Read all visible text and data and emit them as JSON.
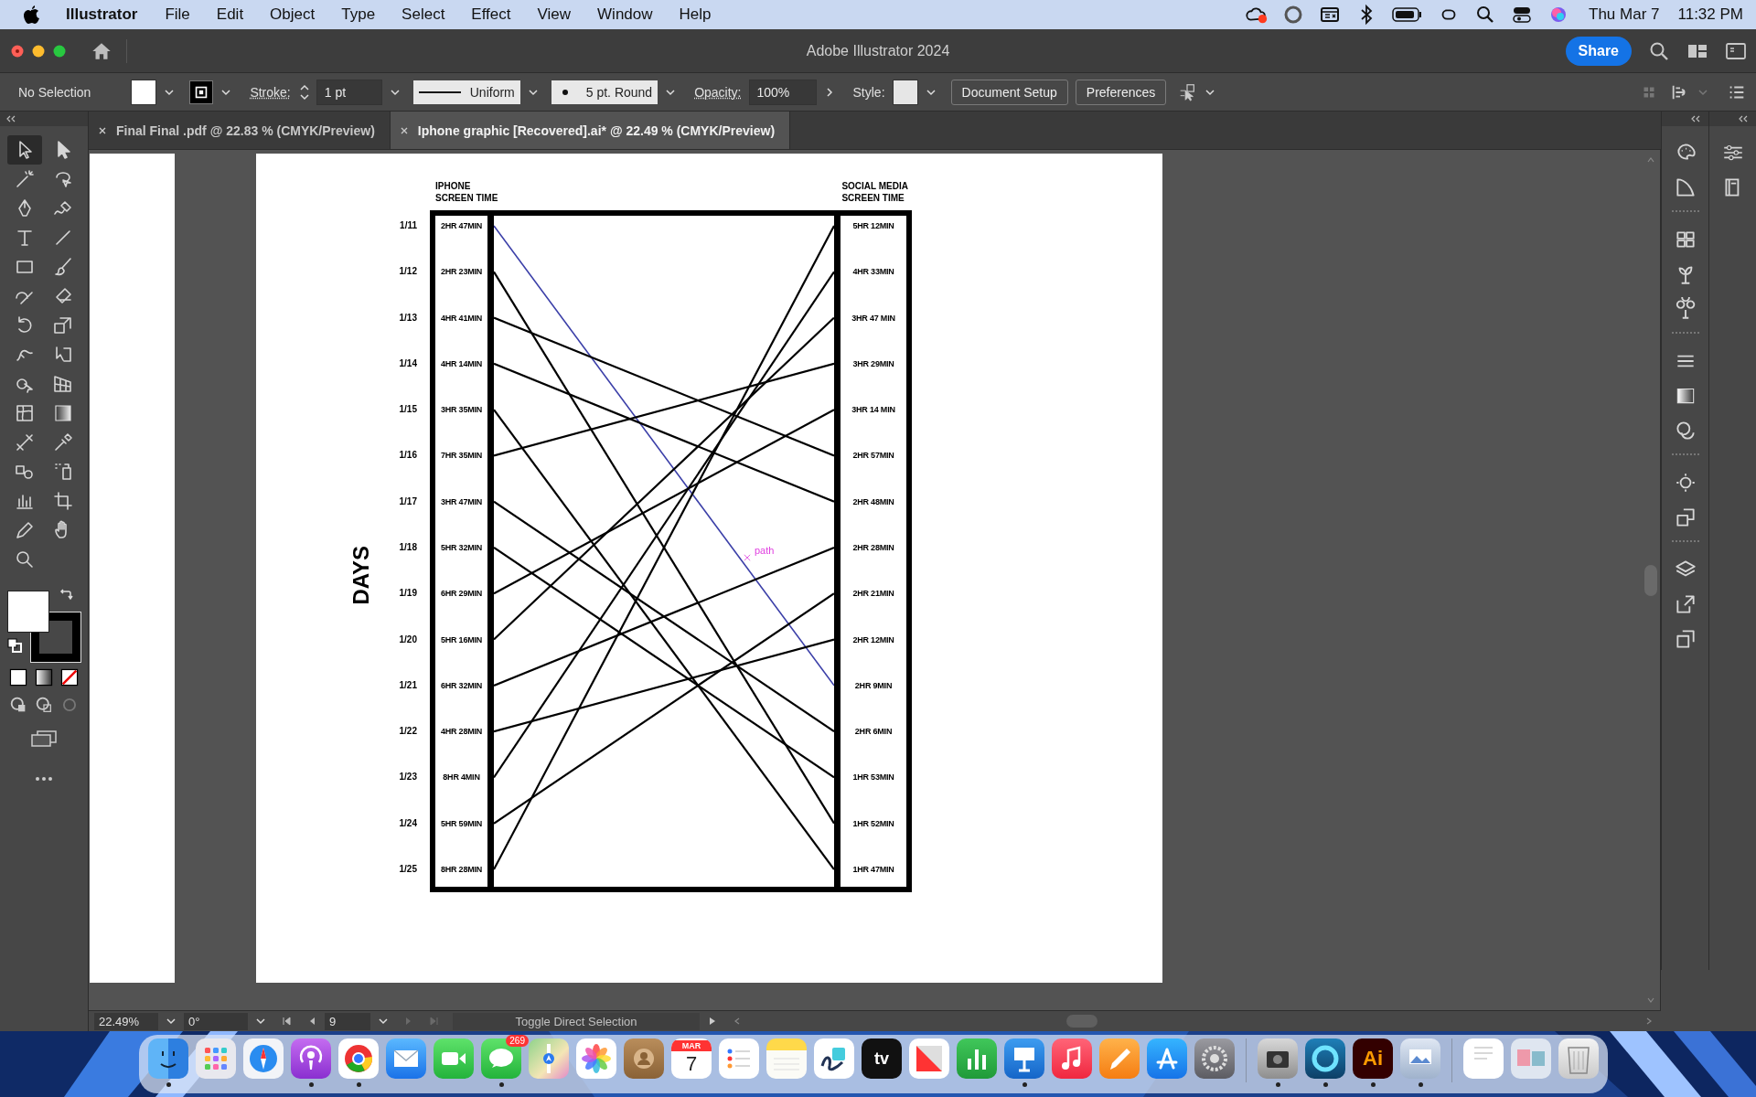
{
  "menu_bar": {
    "app": "Illustrator",
    "menus": [
      "File",
      "Edit",
      "Object",
      "Type",
      "Select",
      "Effect",
      "View",
      "Window",
      "Help"
    ],
    "date": "Thu Mar 7",
    "time": "11:32 PM"
  },
  "window": {
    "title": "Adobe Illustrator 2024",
    "share": "Share"
  },
  "control_bar": {
    "selection": "No Selection",
    "stroke_label": "Stroke:",
    "stroke_value": "1 pt",
    "profile": "Uniform",
    "brush": "5 pt. Round",
    "opacity_label": "Opacity:",
    "opacity_value": "100%",
    "style_label": "Style:",
    "buttons": [
      "Document Setup",
      "Preferences"
    ]
  },
  "tabs": [
    {
      "label": "Final Final .pdf @ 22.83 % (CMYK/Preview)",
      "selected": false
    },
    {
      "label": "Iphone graphic [Recovered].ai* @ 22.49 % (CMYK/Preview)",
      "selected": true
    }
  ],
  "tools": [
    {
      "selected": true
    },
    {
      "selected": false
    },
    {
      "selected": false
    },
    {
      "selected": false
    },
    {
      "selected": false
    },
    {
      "selected": false
    },
    {
      "selected": false
    },
    {
      "selected": false
    },
    {
      "selected": false
    },
    {
      "selected": false
    },
    {
      "selected": false
    },
    {
      "selected": false
    },
    {
      "selected": false
    },
    {
      "selected": false
    },
    {
      "selected": false
    },
    {
      "selected": false
    },
    {
      "selected": false
    },
    {
      "selected": false
    },
    {
      "selected": false
    },
    {
      "selected": false
    },
    {
      "selected": false
    },
    {
      "selected": false
    },
    {
      "selected": false
    },
    {
      "selected": false
    },
    {
      "selected": false
    },
    {
      "selected": false
    },
    {
      "selected": false
    },
    {
      "selected": false
    },
    {
      "selected": false
    }
  ],
  "artboard": {
    "left_header": [
      "IPHONE",
      "SCREEN TIME"
    ],
    "right_header": [
      "SOCIAL MEDIA",
      "SCREEN TIME"
    ],
    "axis_label": "DAYS",
    "path_hint": "path",
    "rows": [
      {
        "date": "1/11",
        "iphone": "2HR 47MIN",
        "social": "5HR 12MIN"
      },
      {
        "date": "1/12",
        "iphone": "2HR 23MIN",
        "social": "4HR 33MIN"
      },
      {
        "date": "1/13",
        "iphone": "4HR 41MIN",
        "social": "3HR 47 MIN"
      },
      {
        "date": "1/14",
        "iphone": "4HR 14MIN",
        "social": "3HR 29MIN"
      },
      {
        "date": "1/15",
        "iphone": "3HR 35MIN",
        "social": "3HR 14 MIN"
      },
      {
        "date": "1/16",
        "iphone": "7HR 35MIN",
        "social": "2HR 57MIN"
      },
      {
        "date": "1/17",
        "iphone": "3HR 47MIN",
        "social": "2HR 48MIN"
      },
      {
        "date": "1/18",
        "iphone": "5HR 32MIN",
        "social": "2HR 28MIN"
      },
      {
        "date": "1/19",
        "iphone": "6HR 29MIN",
        "social": "2HR 21MIN"
      },
      {
        "date": "1/20",
        "iphone": "5HR 16MIN",
        "social": "2HR 12MIN"
      },
      {
        "date": "1/21",
        "iphone": "6HR 32MIN",
        "social": "2HR 9MIN"
      },
      {
        "date": "1/22",
        "iphone": "4HR 28MIN",
        "social": "2HR 6MIN"
      },
      {
        "date": "1/23",
        "iphone": "8HR 4MIN",
        "social": "1HR 53MIN"
      },
      {
        "date": "1/24",
        "iphone": "5HR 59MIN",
        "social": "1HR 52MIN"
      },
      {
        "date": "1/25",
        "iphone": "8HR 28MIN",
        "social": "1HR 47MIN"
      }
    ]
  },
  "status_bar": {
    "zoom": "22.49%",
    "rotation": "0°",
    "artboard": "9",
    "tool": "Toggle Direct Selection"
  },
  "dock": [
    {
      "kind": "finder",
      "running": true
    },
    {
      "kind": "launchpad",
      "running": false
    },
    {
      "kind": "safari",
      "running": false
    },
    {
      "kind": "podcasts",
      "running": true
    },
    {
      "kind": "chrome",
      "running": true
    },
    {
      "kind": "mail",
      "running": false
    },
    {
      "kind": "facetime",
      "running": false
    },
    {
      "kind": "messages",
      "running": true,
      "badge": "269"
    },
    {
      "kind": "maps",
      "running": false
    },
    {
      "kind": "photos",
      "running": false
    },
    {
      "kind": "contacts",
      "running": false
    },
    {
      "kind": "calendar",
      "running": false,
      "month": "MAR",
      "day": "7"
    },
    {
      "kind": "reminders",
      "running": false
    },
    {
      "kind": "notes",
      "running": false
    },
    {
      "kind": "freeform",
      "running": false
    },
    {
      "kind": "tv",
      "running": false,
      "label": "tv"
    },
    {
      "kind": "news",
      "running": false
    },
    {
      "kind": "numbers",
      "running": false
    },
    {
      "kind": "keynote",
      "running": true
    },
    {
      "kind": "music",
      "running": false
    },
    {
      "kind": "pages",
      "running": false
    },
    {
      "kind": "appstore",
      "running": false
    },
    {
      "kind": "settings",
      "running": false
    },
    {
      "kind": "separator"
    },
    {
      "kind": "screenshot",
      "running": true
    },
    {
      "kind": "ring",
      "running": true
    },
    {
      "kind": "illustrator",
      "running": true,
      "label": "Ai"
    },
    {
      "kind": "preview",
      "running": true
    },
    {
      "kind": "separator"
    },
    {
      "kind": "document",
      "running": false
    },
    {
      "kind": "thumbnail",
      "running": false
    },
    {
      "kind": "trash",
      "running": false
    }
  ]
}
